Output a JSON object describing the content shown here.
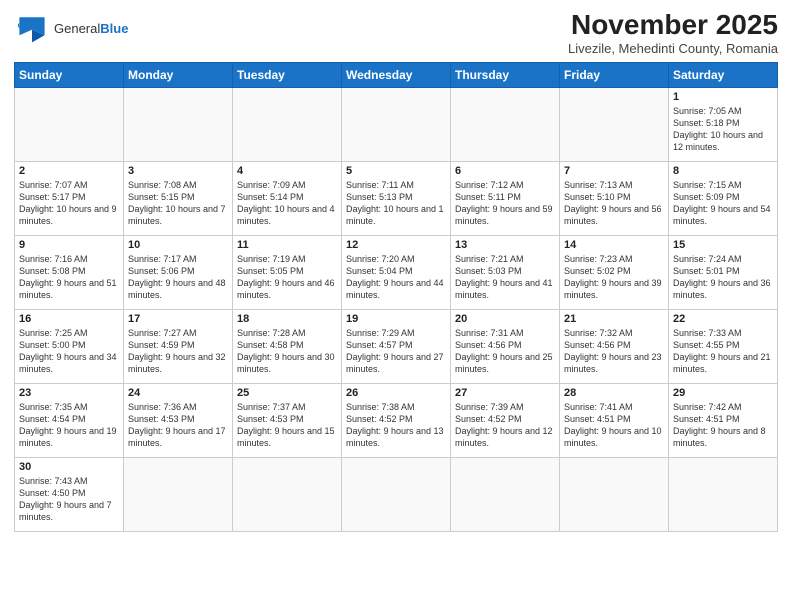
{
  "header": {
    "logo_general": "General",
    "logo_blue": "Blue",
    "month_year": "November 2025",
    "location": "Livezile, Mehedinti County, Romania"
  },
  "weekdays": [
    "Sunday",
    "Monday",
    "Tuesday",
    "Wednesday",
    "Thursday",
    "Friday",
    "Saturday"
  ],
  "weeks": [
    [
      {
        "day": "",
        "info": ""
      },
      {
        "day": "",
        "info": ""
      },
      {
        "day": "",
        "info": ""
      },
      {
        "day": "",
        "info": ""
      },
      {
        "day": "",
        "info": ""
      },
      {
        "day": "",
        "info": ""
      },
      {
        "day": "1",
        "info": "Sunrise: 7:05 AM\nSunset: 5:18 PM\nDaylight: 10 hours\nand 12 minutes."
      }
    ],
    [
      {
        "day": "2",
        "info": "Sunrise: 7:07 AM\nSunset: 5:17 PM\nDaylight: 10 hours\nand 9 minutes."
      },
      {
        "day": "3",
        "info": "Sunrise: 7:08 AM\nSunset: 5:15 PM\nDaylight: 10 hours\nand 7 minutes."
      },
      {
        "day": "4",
        "info": "Sunrise: 7:09 AM\nSunset: 5:14 PM\nDaylight: 10 hours\nand 4 minutes."
      },
      {
        "day": "5",
        "info": "Sunrise: 7:11 AM\nSunset: 5:13 PM\nDaylight: 10 hours\nand 1 minute."
      },
      {
        "day": "6",
        "info": "Sunrise: 7:12 AM\nSunset: 5:11 PM\nDaylight: 9 hours\nand 59 minutes."
      },
      {
        "day": "7",
        "info": "Sunrise: 7:13 AM\nSunset: 5:10 PM\nDaylight: 9 hours\nand 56 minutes."
      },
      {
        "day": "8",
        "info": "Sunrise: 7:15 AM\nSunset: 5:09 PM\nDaylight: 9 hours\nand 54 minutes."
      }
    ],
    [
      {
        "day": "9",
        "info": "Sunrise: 7:16 AM\nSunset: 5:08 PM\nDaylight: 9 hours\nand 51 minutes."
      },
      {
        "day": "10",
        "info": "Sunrise: 7:17 AM\nSunset: 5:06 PM\nDaylight: 9 hours\nand 48 minutes."
      },
      {
        "day": "11",
        "info": "Sunrise: 7:19 AM\nSunset: 5:05 PM\nDaylight: 9 hours\nand 46 minutes."
      },
      {
        "day": "12",
        "info": "Sunrise: 7:20 AM\nSunset: 5:04 PM\nDaylight: 9 hours\nand 44 minutes."
      },
      {
        "day": "13",
        "info": "Sunrise: 7:21 AM\nSunset: 5:03 PM\nDaylight: 9 hours\nand 41 minutes."
      },
      {
        "day": "14",
        "info": "Sunrise: 7:23 AM\nSunset: 5:02 PM\nDaylight: 9 hours\nand 39 minutes."
      },
      {
        "day": "15",
        "info": "Sunrise: 7:24 AM\nSunset: 5:01 PM\nDaylight: 9 hours\nand 36 minutes."
      }
    ],
    [
      {
        "day": "16",
        "info": "Sunrise: 7:25 AM\nSunset: 5:00 PM\nDaylight: 9 hours\nand 34 minutes."
      },
      {
        "day": "17",
        "info": "Sunrise: 7:27 AM\nSunset: 4:59 PM\nDaylight: 9 hours\nand 32 minutes."
      },
      {
        "day": "18",
        "info": "Sunrise: 7:28 AM\nSunset: 4:58 PM\nDaylight: 9 hours\nand 30 minutes."
      },
      {
        "day": "19",
        "info": "Sunrise: 7:29 AM\nSunset: 4:57 PM\nDaylight: 9 hours\nand 27 minutes."
      },
      {
        "day": "20",
        "info": "Sunrise: 7:31 AM\nSunset: 4:56 PM\nDaylight: 9 hours\nand 25 minutes."
      },
      {
        "day": "21",
        "info": "Sunrise: 7:32 AM\nSunset: 4:56 PM\nDaylight: 9 hours\nand 23 minutes."
      },
      {
        "day": "22",
        "info": "Sunrise: 7:33 AM\nSunset: 4:55 PM\nDaylight: 9 hours\nand 21 minutes."
      }
    ],
    [
      {
        "day": "23",
        "info": "Sunrise: 7:35 AM\nSunset: 4:54 PM\nDaylight: 9 hours\nand 19 minutes."
      },
      {
        "day": "24",
        "info": "Sunrise: 7:36 AM\nSunset: 4:53 PM\nDaylight: 9 hours\nand 17 minutes."
      },
      {
        "day": "25",
        "info": "Sunrise: 7:37 AM\nSunset: 4:53 PM\nDaylight: 9 hours\nand 15 minutes."
      },
      {
        "day": "26",
        "info": "Sunrise: 7:38 AM\nSunset: 4:52 PM\nDaylight: 9 hours\nand 13 minutes."
      },
      {
        "day": "27",
        "info": "Sunrise: 7:39 AM\nSunset: 4:52 PM\nDaylight: 9 hours\nand 12 minutes."
      },
      {
        "day": "28",
        "info": "Sunrise: 7:41 AM\nSunset: 4:51 PM\nDaylight: 9 hours\nand 10 minutes."
      },
      {
        "day": "29",
        "info": "Sunrise: 7:42 AM\nSunset: 4:51 PM\nDaylight: 9 hours\nand 8 minutes."
      }
    ],
    [
      {
        "day": "30",
        "info": "Sunrise: 7:43 AM\nSunset: 4:50 PM\nDaylight: 9 hours\nand 7 minutes."
      },
      {
        "day": "",
        "info": ""
      },
      {
        "day": "",
        "info": ""
      },
      {
        "day": "",
        "info": ""
      },
      {
        "day": "",
        "info": ""
      },
      {
        "day": "",
        "info": ""
      },
      {
        "day": "",
        "info": ""
      }
    ]
  ]
}
